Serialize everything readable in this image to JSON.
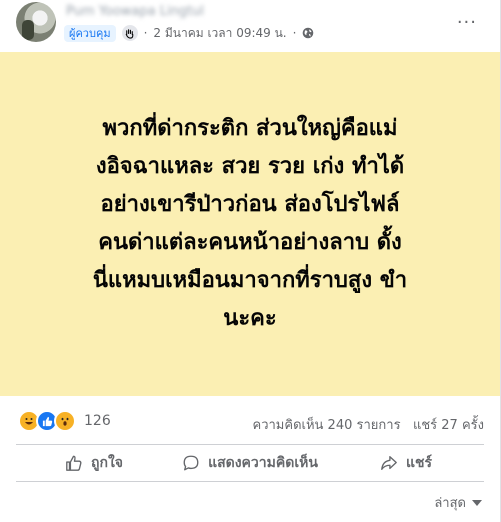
{
  "header": {
    "author_name": "Pum Yoowapa Lingtul",
    "role_badge": "ผู้ควบคุม",
    "timestamp": "2 มีนาคม เวลา 09:49 น.",
    "separator": "·",
    "more_label": "···"
  },
  "post": {
    "background_color": "#fbefb3",
    "lines": [
      "พวกที่ด่ากระติก ส่วนใหญ่คือแม่",
      "งอิจฉาแหละ สวย รวย เก่ง ทำได้",
      "อย่างเขารีป่าวก่อน ส่องโปรไฟล์",
      "คนด่าแต่ละคนหน้าอย่างลาบ ดั้ง",
      "นี่แหมบเหมือนมาจากที่ราบสูง ขำ",
      "นะคะ"
    ]
  },
  "engagement": {
    "reaction_icons": [
      "haha-icon",
      "like-icon",
      "wow-icon"
    ],
    "reaction_count": "126",
    "comments": "ความคิดเห็น 240 รายการ",
    "shares": "แชร์ 27 ครั้ง"
  },
  "actions": {
    "like": "ถูกใจ",
    "comment": "แสดงความคิดเห็น",
    "share": "แชร์"
  },
  "comments_sort": {
    "selected": "ล่าสุด"
  }
}
